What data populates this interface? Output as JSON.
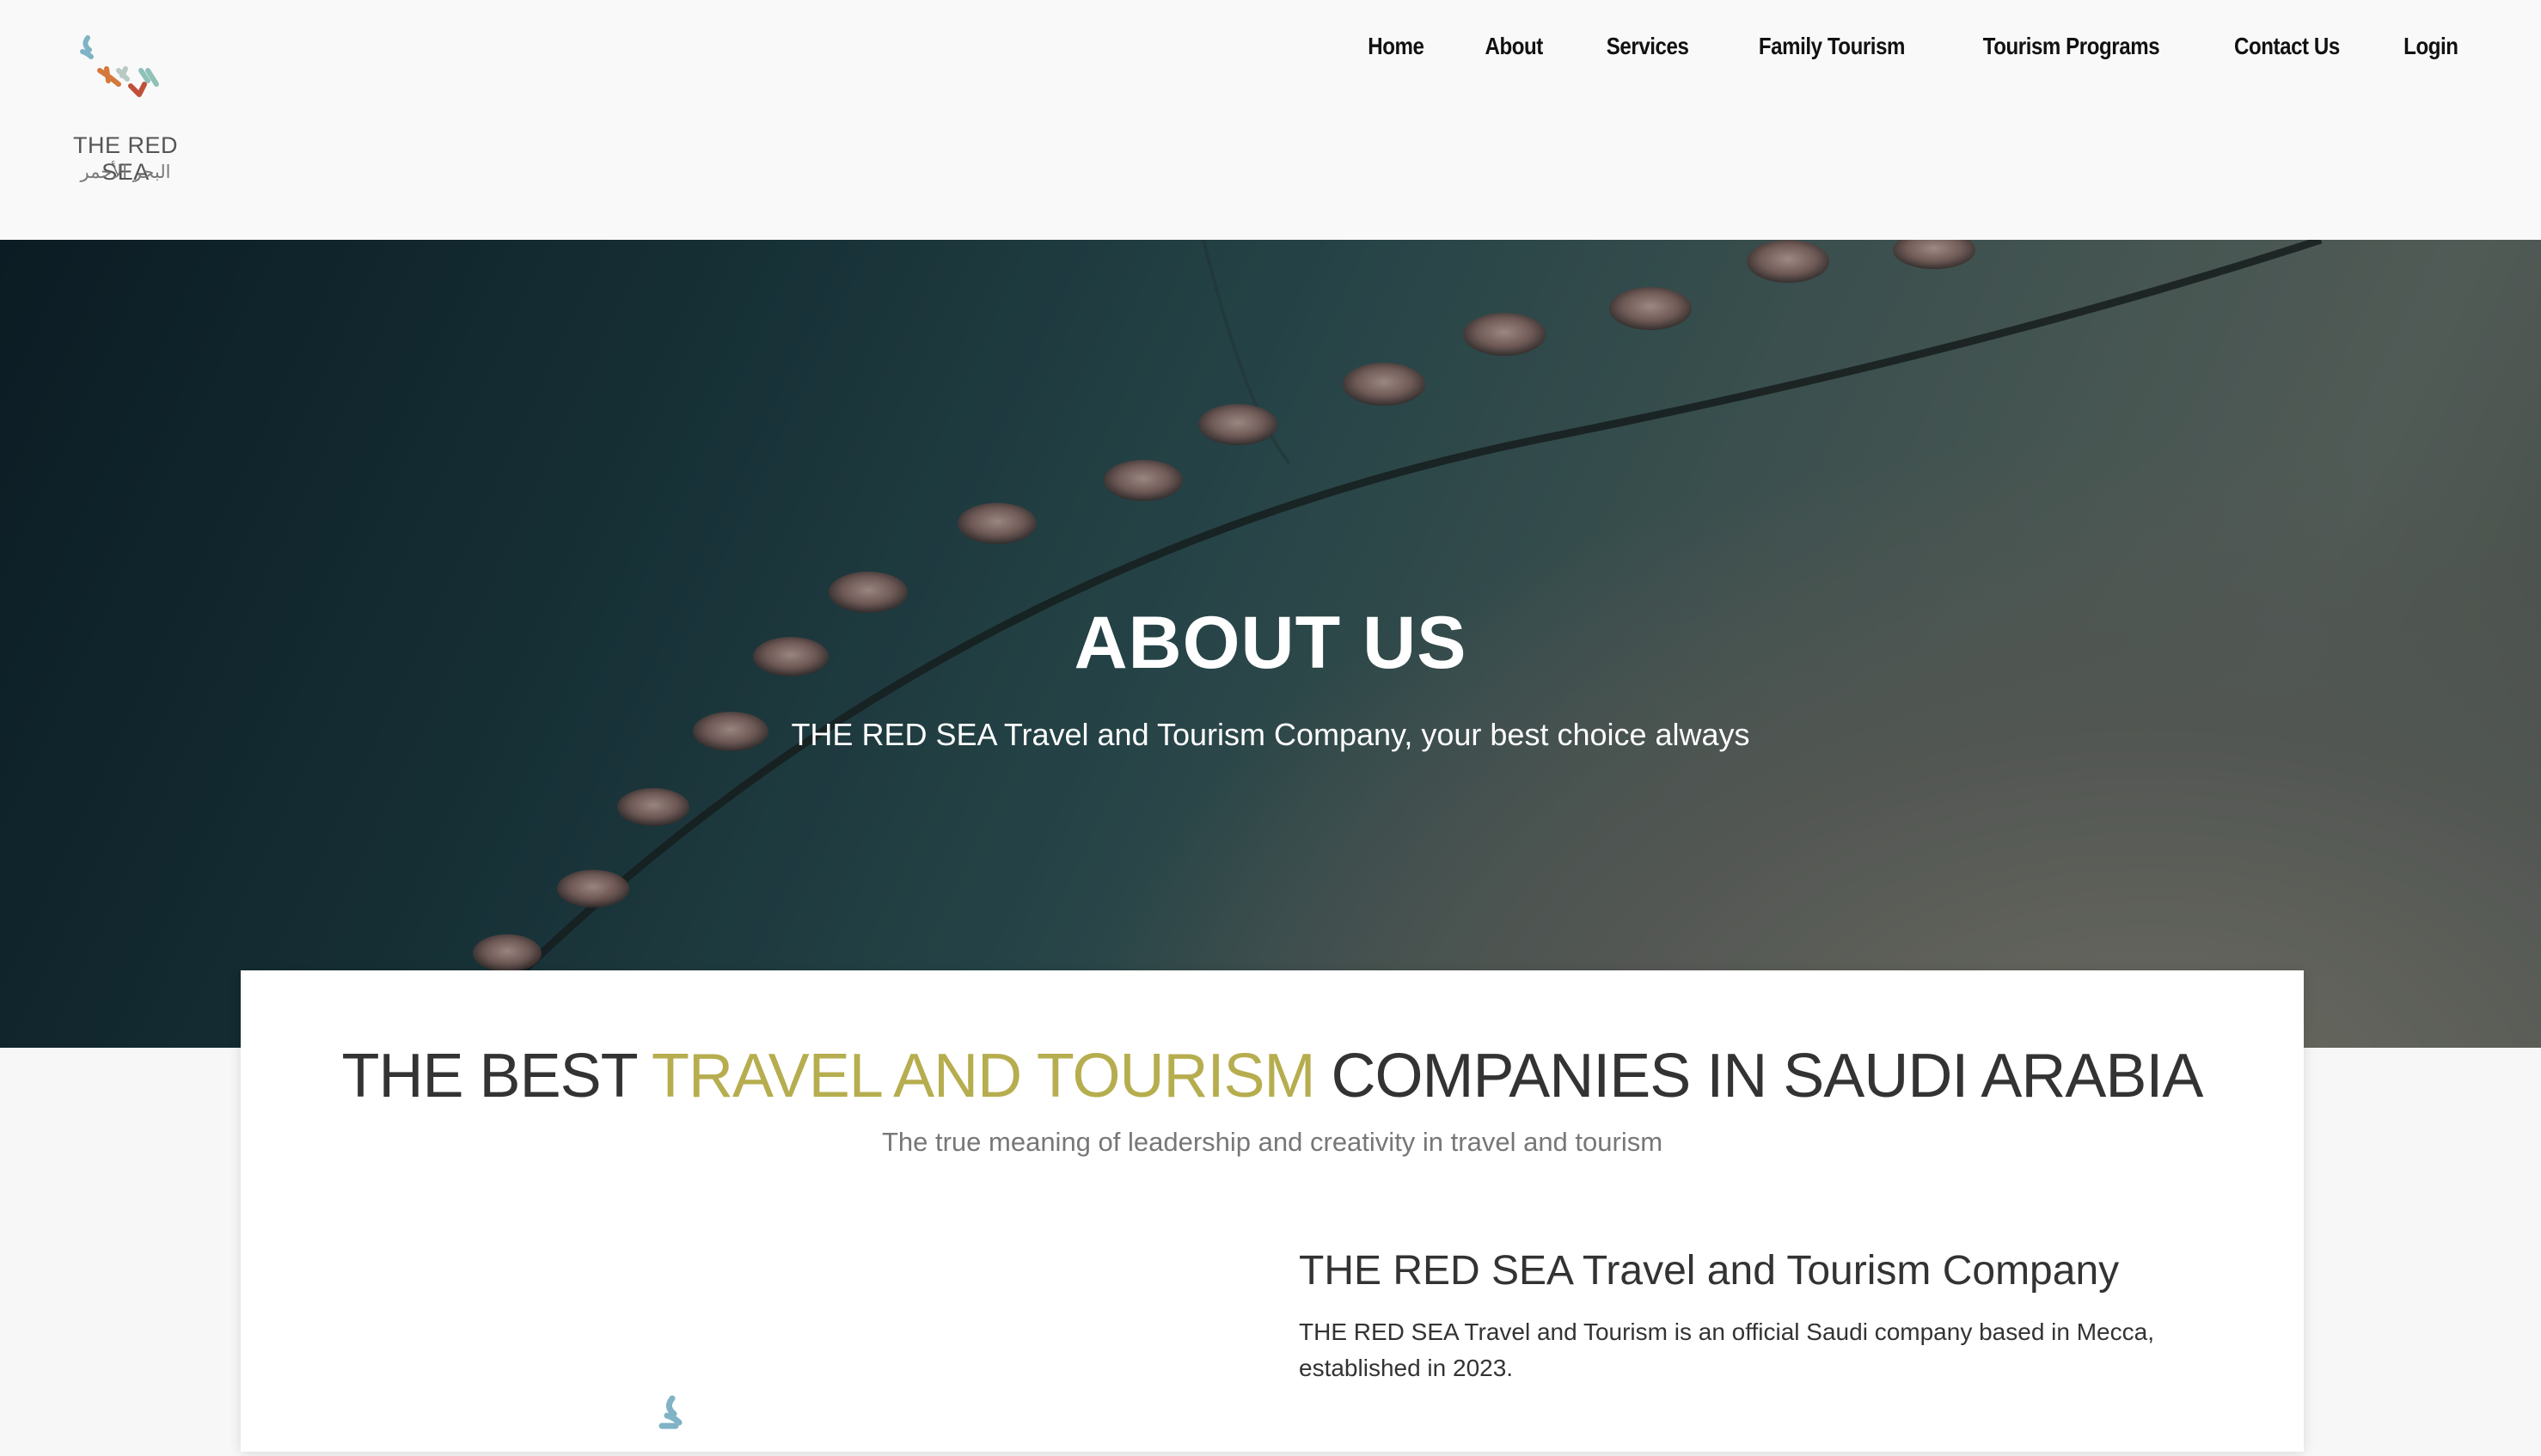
{
  "header": {
    "logo": {
      "text_en": "THE RED SEA",
      "text_ar": "البحر الأحمر",
      "icon": "red-sea-logo-icon",
      "colors": [
        "#7fb3c5",
        "#d4793c",
        "#c0503a",
        "#8fc1b8"
      ]
    },
    "nav": [
      {
        "label": "Home"
      },
      {
        "label": "About"
      },
      {
        "label": "Services"
      },
      {
        "label": "Family Tourism"
      },
      {
        "label": "Tourism Programs"
      },
      {
        "label": "Contact Us"
      },
      {
        "label": "Login"
      }
    ]
  },
  "hero": {
    "title": "ABOUT US",
    "subtitle": "THE RED SEA Travel and Tourism Company, your best choice always"
  },
  "intro": {
    "title_part1": "THE BEST ",
    "title_accent": "TRAVEL AND TOURISM",
    "title_part2": " COMPANIES IN SAUDI ARABIA",
    "subtitle": "The true meaning of leadership and creativity in travel and tourism",
    "accent_color": "#b6ad4f"
  },
  "company": {
    "title": "THE RED SEA Travel and Tourism Company",
    "text": "THE RED SEA Travel and Tourism is an official Saudi company based in Mecca, established in 2023."
  }
}
